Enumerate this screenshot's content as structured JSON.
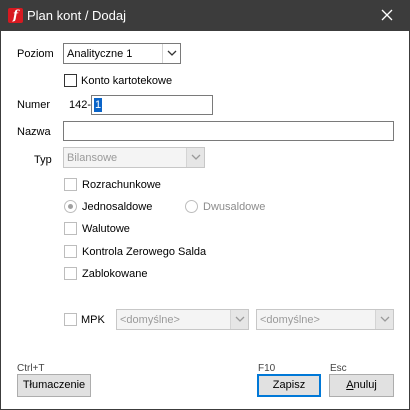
{
  "window": {
    "title": "Plan kont / Dodaj",
    "app_icon_letter": "f"
  },
  "form": {
    "poziom": {
      "label": "Poziom",
      "value": "Analityczne 1"
    },
    "konto_kartotekowe": {
      "label": "Konto kartotekowe",
      "checked": false
    },
    "numer": {
      "label": "Numer",
      "prefix": "142-",
      "value": "1"
    },
    "nazwa": {
      "label": "Nazwa",
      "value": ""
    },
    "typ": {
      "label": "Typ",
      "value": "Bilansowe",
      "enabled": false
    },
    "rozrachunkowe": {
      "label": "Rozrachunkowe",
      "checked": false,
      "enabled": false
    },
    "saldo_mode": {
      "options": [
        {
          "label": "Jednosaldowe",
          "selected": true
        },
        {
          "label": "Dwusaldowe",
          "selected": false
        }
      ],
      "enabled": false
    },
    "walutowe": {
      "label": "Walutowe",
      "checked": false,
      "enabled": false
    },
    "kontrola_zerowego_salda": {
      "label": "Kontrola Zerowego Salda",
      "checked": false,
      "enabled": false
    },
    "zablokowane": {
      "label": "Zablokowane",
      "checked": false,
      "enabled": false
    },
    "mpk": {
      "label": "MPK",
      "checked": false,
      "enabled": false,
      "select1": "<domyślne>",
      "select2": "<domyślne>"
    }
  },
  "footer": {
    "tlumaczenie": {
      "shortcut": "Ctrl+T",
      "label": "Tłumaczenie"
    },
    "zapisz": {
      "shortcut": "F10",
      "label": "Zapisz"
    },
    "anuluj": {
      "shortcut": "Esc",
      "label_underlined": "A",
      "label_rest": "nuluj"
    }
  },
  "colors": {
    "titlebar": "#3c3c3c",
    "app_icon": "#d71920",
    "selection": "#0a64c8",
    "focus_border": "#0078d7"
  }
}
